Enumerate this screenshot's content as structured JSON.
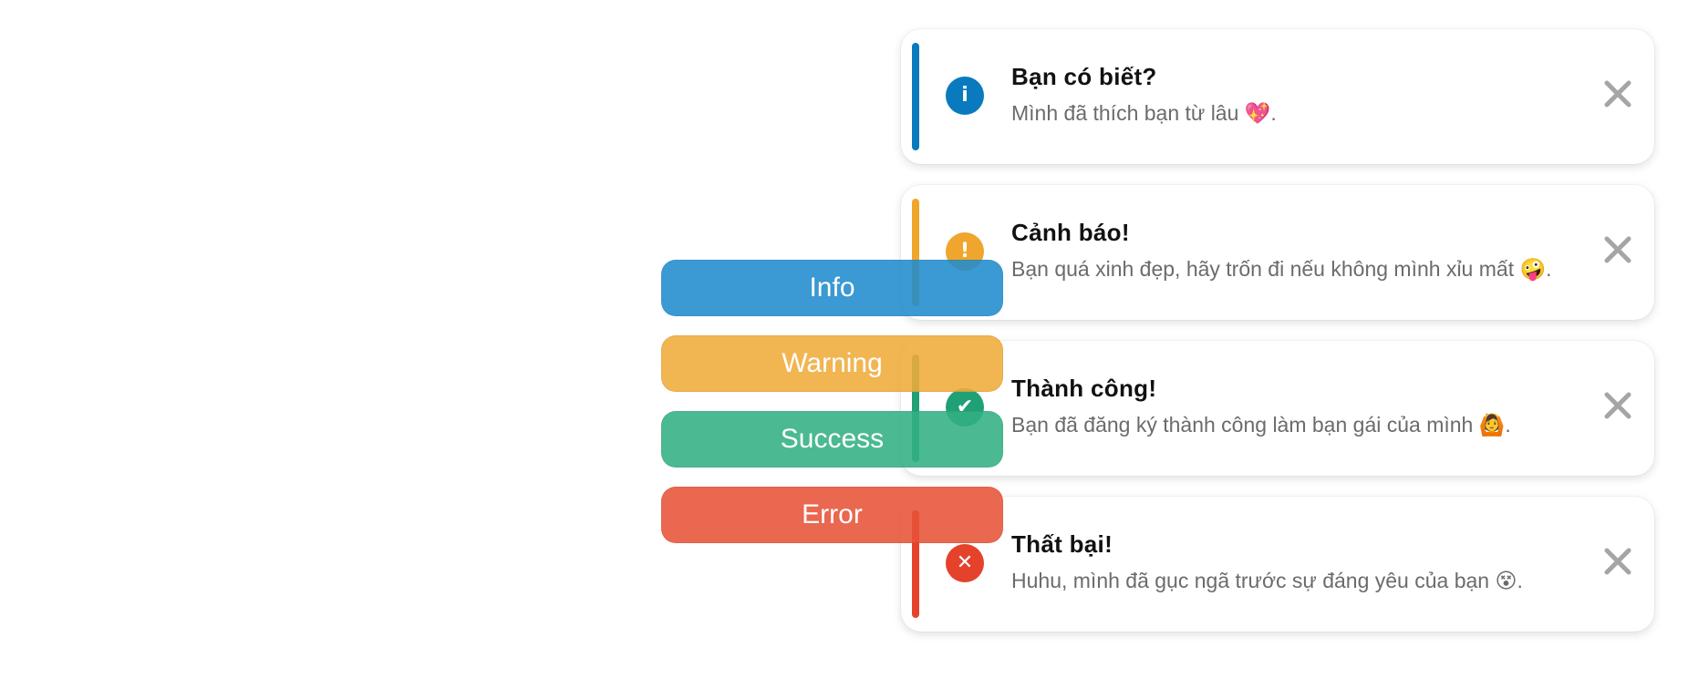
{
  "toasts": [
    {
      "type": "info",
      "title": "Bạn có biết?",
      "message": "Mình đã thích bạn từ lâu",
      "emoji": "💖",
      "suffix": ".",
      "icon": "info-icon",
      "icon_glyph": "i",
      "color": "#0a7abf"
    },
    {
      "type": "warning",
      "title": "Cảnh báo!",
      "message": "Bạn quá xinh đẹp, hãy trốn đi nếu không mình xỉu mất",
      "emoji": "🤪",
      "suffix": ".",
      "icon": "exclamation-icon",
      "icon_glyph": "!",
      "color": "#f0a52c"
    },
    {
      "type": "success",
      "title": "Thành công!",
      "message": "Bạn đã đăng ký thành công làm bạn gái của mình",
      "emoji": "🙆",
      "suffix": ".",
      "icon": "checkmark-icon",
      "icon_glyph": "✔",
      "color": "#1fa076"
    },
    {
      "type": "error",
      "title": "Thất bại!",
      "message": "Huhu, mình đã gục ngã trước sự đáng yêu của bạn",
      "emoji": "😵",
      "suffix": ".",
      "icon": "x-icon",
      "icon_glyph": "✕",
      "color": "#e5422b"
    }
  ],
  "close_icon": "close-icon",
  "close_color": "#a5a5a5",
  "buttons": [
    {
      "label": "Info",
      "color": "#218cce"
    },
    {
      "label": "Warning",
      "color": "#f0ab3b"
    },
    {
      "label": "Success",
      "color": "#33b084"
    },
    {
      "label": "Error",
      "color": "#e85339"
    }
  ]
}
